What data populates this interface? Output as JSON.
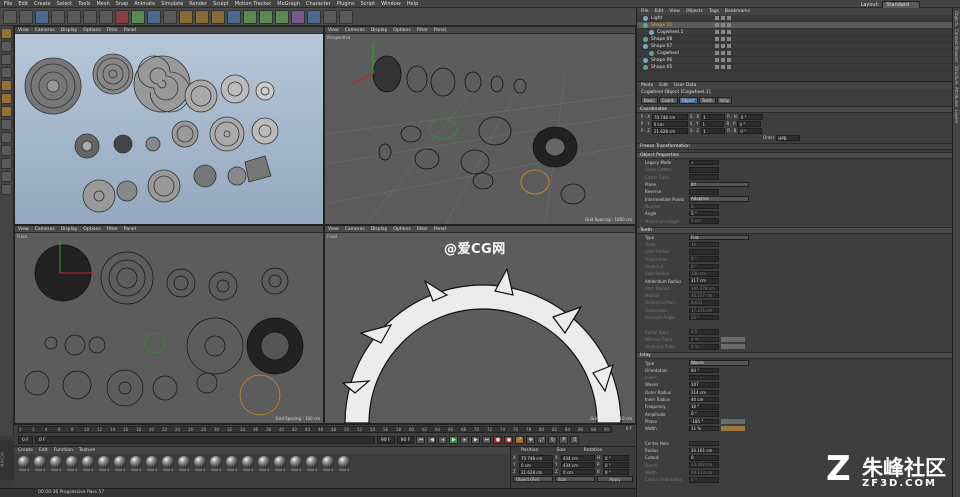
{
  "menu": [
    "File",
    "Edit",
    "Create",
    "Select",
    "Tools",
    "Mesh",
    "Snap",
    "Animate",
    "Simulate",
    "Render",
    "Sculpt",
    "Motion Tracker",
    "MoGraph",
    "Character",
    "Plugins",
    "Script",
    "Window",
    "Help"
  ],
  "layout": {
    "label": "Layout:",
    "value": "Standard"
  },
  "viewports": [
    {
      "menu": [
        "View",
        "Cameras",
        "Display",
        "Options",
        "Filter",
        "Panel"
      ],
      "label": "",
      "grid": ""
    },
    {
      "menu": [
        "View",
        "Cameras",
        "Display",
        "Options",
        "Filter",
        "Panel"
      ],
      "label": "Perspective",
      "grid": "Grid Spacing : 1000 cm"
    },
    {
      "menu": [
        "View",
        "Cameras",
        "Display",
        "Options",
        "Filter",
        "Panel"
      ],
      "label": "Front",
      "grid": "Grid Spacing : 100 cm"
    },
    {
      "menu": [
        "View",
        "Cameras",
        "Display",
        "Options",
        "Filter",
        "Panel"
      ],
      "label": "Front",
      "grid": "Grid Spacing : 10 cm"
    }
  ],
  "timeline": {
    "ticks": [
      "0",
      "2",
      "4",
      "6",
      "8",
      "10",
      "12",
      "14",
      "16",
      "18",
      "20",
      "22",
      "24",
      "26",
      "28",
      "30",
      "32",
      "34",
      "36",
      "38",
      "40",
      "42",
      "44",
      "46",
      "48",
      "50",
      "52",
      "54",
      "56",
      "58",
      "60",
      "62",
      "64",
      "66",
      "68",
      "70",
      "72",
      "74",
      "76",
      "78",
      "80",
      "82",
      "84",
      "86",
      "88",
      "90"
    ],
    "end_label": "0 F",
    "start": "0 F",
    "current": "0 F",
    "end": "90 F",
    "max": "90 F"
  },
  "materials": {
    "menu": [
      "Create",
      "Edit",
      "Function",
      "Texture"
    ],
    "items": [
      "Mat.2",
      "Mat.2",
      "Mat.2",
      "Mat.2",
      "Mat.2",
      "Mat.2",
      "Mat.2",
      "Mat.2",
      "Mat.2",
      "Mat.2",
      "Mat.2",
      "Mat.2",
      "Mat.2",
      "Mat.2",
      "Mat.2",
      "Mat.2",
      "Mat.2",
      "Mat.2",
      "Mat.2",
      "Mat.2",
      "Mat.2"
    ]
  },
  "status": "00:00:36 Progressive Pass 57",
  "coords": {
    "headers": [
      "Position",
      "Size",
      "Rotation"
    ],
    "rows": [
      {
        "axis": "X",
        "pos": "70.748 cm",
        "size": "434 cm",
        "rlabel": "H",
        "rot": "0 °"
      },
      {
        "axis": "Y",
        "pos": "0 cm",
        "size": "434 cm",
        "rlabel": "P",
        "rot": "0 °"
      },
      {
        "axis": "Z",
        "pos": "21.628 cm",
        "size": "0 cm",
        "rlabel": "B",
        "rot": "0 °"
      }
    ],
    "mode": "Object (Rel)",
    "size_mode": "Size",
    "apply": "Apply"
  },
  "objects": {
    "menu": [
      "File",
      "Edit",
      "View",
      "Objects",
      "Tags",
      "Bookmarks"
    ],
    "items": [
      {
        "name": "Light",
        "selected": false
      },
      {
        "name": "Shape 11",
        "selected": true
      },
      {
        "name": "Cogwheel.1",
        "selected": false
      },
      {
        "name": "Shape 08",
        "selected": false
      },
      {
        "name": "Shape 07",
        "selected": false
      },
      {
        "name": "Cogwheel",
        "selected": false
      },
      {
        "name": "Shape 06",
        "selected": false
      },
      {
        "name": "Shape 05",
        "selected": false
      }
    ]
  },
  "attributes": {
    "menu": [
      "Mode",
      "Edit",
      "User Data"
    ],
    "title": "Cogwheel Object [Cogwheel.1]",
    "tabs": [
      "Basic",
      "Coord.",
      "Object",
      "Teeth",
      "Inlay"
    ],
    "active_tab": "Object",
    "coordinates": {
      "label": "Coordinates",
      "rows": [
        {
          "p": "P . X",
          "pv": "70.748 cm",
          "s": "S . X",
          "sv": "1",
          "r": "R . H",
          "rv": "0 °"
        },
        {
          "p": "P . Y",
          "pv": "0 cm",
          "s": "S . Y",
          "sv": "1",
          "r": "R . P",
          "rv": "0 °"
        },
        {
          "p": "P . Z",
          "pv": "21.628 cm",
          "s": "S . Z",
          "sv": "1",
          "r": "R . B",
          "rv": "0 °"
        }
      ],
      "order_label": "Order",
      "order": "HPB",
      "freeze": "Freeze Transformation"
    },
    "object_props": {
      "label": "Object Properties",
      "rows": [
        {
          "k": "Legacy Mode",
          "v": "✓",
          "dim": false
        },
        {
          "k": "Show Cutters",
          "v": "",
          "dim": true
        },
        {
          "k": "Cutter Color",
          "v": "",
          "dim": true
        },
        {
          "k": "Plane",
          "v": "XY",
          "dim": false,
          "wide": true
        },
        {
          "k": "Reverse",
          "v": "",
          "dim": false
        },
        {
          "k": "Intermediate Points",
          "v": "Adaptive",
          "dim": false,
          "wide": true
        },
        {
          "k": "Number",
          "v": "8",
          "dim": true
        },
        {
          "k": "Angle",
          "v": "5 °",
          "dim": false
        },
        {
          "k": "Maximum Length",
          "v": "5 cm",
          "dim": true
        }
      ]
    },
    "teeth": {
      "label": "Teeth",
      "rows": [
        {
          "k": "Type",
          "v": "Flat",
          "dim": false,
          "wide": true
        },
        {
          "k": "Teeth",
          "v": "16",
          "dim": true
        },
        {
          "k": "Limit Radius",
          "v": "",
          "dim": true
        },
        {
          "k": "Orientation",
          "v": "0 °",
          "dim": true
        },
        {
          "k": "Undercut",
          "v": "0 °",
          "dim": true
        },
        {
          "k": "Root Radius",
          "v": "100 cm",
          "dim": true
        },
        {
          "k": "Addendum Radius",
          "v": "217 cm",
          "dim": false
        },
        {
          "k": "Pitch Radius",
          "v": "185.278 cm",
          "dim": true
        },
        {
          "k": "Module",
          "v": "20.727 cm",
          "dim": true
        },
        {
          "k": "Diametral Pitch",
          "v": "0.031",
          "dim": true
        },
        {
          "k": "Dedendum",
          "v": "17.271 cm",
          "dim": true
        },
        {
          "k": "Pressure Angle",
          "v": "20 °",
          "dim": true
        },
        {
          "k": "",
          "v": "",
          "dim": true
        },
        {
          "k": "Radial Ratio",
          "v": "0.5",
          "dim": true
        },
        {
          "k": "Witness Ratio",
          "v": "0 %",
          "dim": true,
          "bar": true
        },
        {
          "k": "Undercut Ratio",
          "v": "0 %",
          "dim": true,
          "bar": true
        }
      ]
    },
    "inlay": {
      "label": "Inlay",
      "rows": [
        {
          "k": "Type",
          "v": "Waves",
          "dim": false,
          "wide": true
        },
        {
          "k": "Orientation",
          "v": "84 °",
          "dim": false
        },
        {
          "k": "Invert",
          "v": "",
          "dim": true
        },
        {
          "k": "Waves",
          "v": "107",
          "dim": false
        },
        {
          "k": "Outer Radius",
          "v": "214 cm",
          "dim": false
        },
        {
          "k": "Inner Radius",
          "v": "40 cm",
          "dim": false
        },
        {
          "k": "Frequency",
          "v": "10 °",
          "dim": false
        },
        {
          "k": "Amplitude",
          "v": "0 °",
          "dim": false
        },
        {
          "k": "Phase",
          "v": "-185 °",
          "dim": false,
          "bar": true
        },
        {
          "k": "Width",
          "v": "11 %",
          "dim": false,
          "obar": true
        },
        {
          "k": "",
          "v": "",
          "dim": true
        },
        {
          "k": "Center Hole",
          "v": "",
          "dim": false
        },
        {
          "k": "Radius",
          "v": "20.161 cm",
          "dim": false
        },
        {
          "k": "Cutout",
          "v": "0",
          "dim": false
        },
        {
          "k": "Depth",
          "v": "13.402 cm",
          "dim": true
        },
        {
          "k": "Width",
          "v": "28.113 cm",
          "dim": true
        },
        {
          "k": "Cutout Orientation",
          "v": "0 °",
          "dim": true
        }
      ]
    }
  },
  "side_tabs": [
    "Objects",
    "Content Browser",
    "Structure",
    "Attributes",
    "Layers"
  ],
  "watermarks": {
    "top": "@爱CG网",
    "brand_cn": "朱峰社区",
    "brand_url": "ZF3D.COM",
    "brand_mark": "Z"
  }
}
